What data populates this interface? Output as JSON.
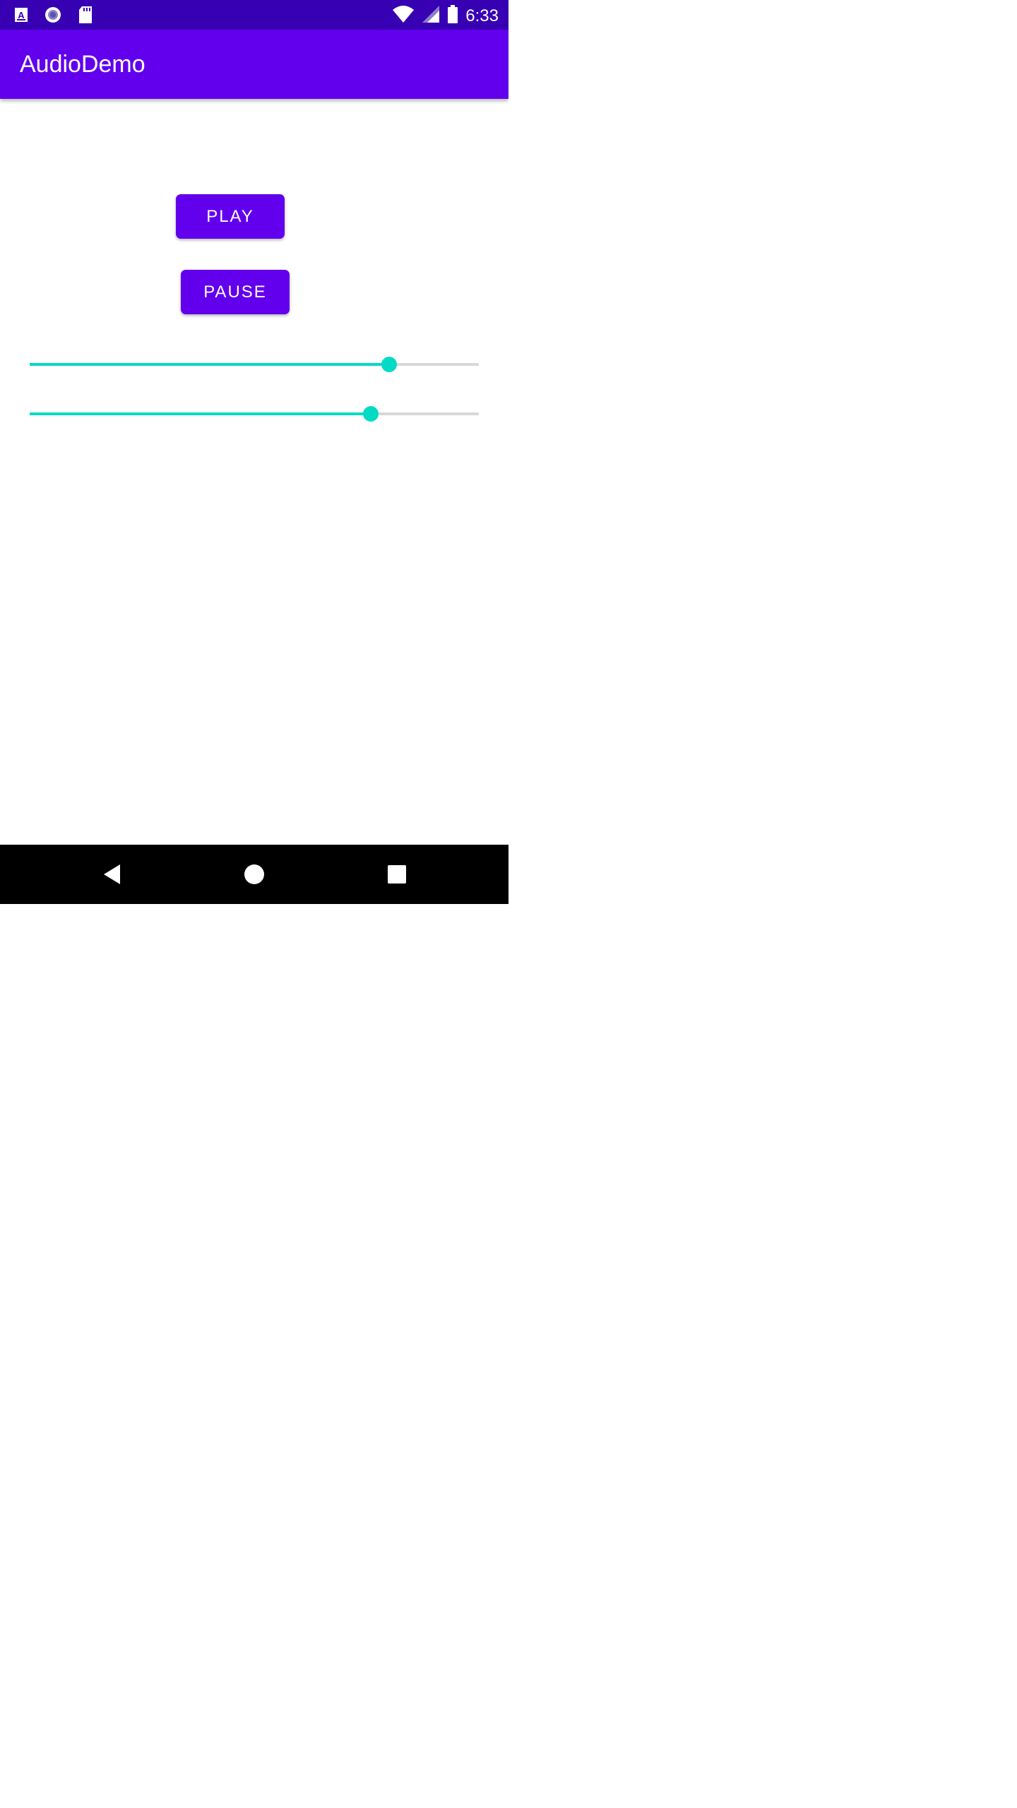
{
  "status_bar": {
    "time": "6:33",
    "icons": [
      "a-notification-icon",
      "circle-notification-icon",
      "sd-card-icon",
      "wifi-icon",
      "cell-signal-icon",
      "battery-icon"
    ]
  },
  "app_bar": {
    "title": "AudioDemo"
  },
  "buttons": {
    "play_label": "PLAY",
    "pause_label": "PAUSE"
  },
  "sliders": [
    {
      "name": "slider-1",
      "value_fraction": 0.8
    },
    {
      "name": "slider-2",
      "value_fraction": 0.76
    }
  ],
  "nav_bar": {
    "icons": [
      "back-icon",
      "home-icon",
      "recents-icon"
    ]
  },
  "colors": {
    "status_bar": "#3700b3",
    "primary": "#6200ee",
    "accent": "#03dac5",
    "track": "#d8d8d8",
    "nav_bar": "#000000"
  }
}
